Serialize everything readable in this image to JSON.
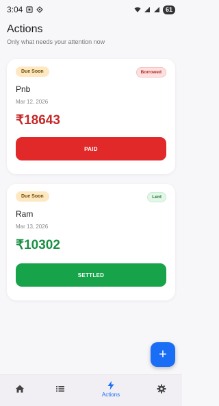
{
  "status_bar": {
    "time": "3:04",
    "battery": "61"
  },
  "header": {
    "title": "Actions",
    "subtitle": "Only what needs your attention now"
  },
  "cards": [
    {
      "due_badge": "Due Soon",
      "type_badge": "Borrowed",
      "name": "Pnb",
      "date": "Mar 12, 2026",
      "amount": "₹18643",
      "button_label": "PAID",
      "amount_color": "#c62828",
      "button_color": "#e12929"
    },
    {
      "due_badge": "Due Soon",
      "type_badge": "Lent",
      "name": "Ram",
      "date": "Mar 13, 2026",
      "amount": "₹10302",
      "button_label": "SETTLED",
      "amount_color": "#1a8f44",
      "button_color": "#16a34a"
    }
  ],
  "fab": {
    "icon": "plus-icon",
    "label": "+"
  },
  "bottom_nav": {
    "items": [
      {
        "icon": "home-icon",
        "label": ""
      },
      {
        "icon": "list-icon",
        "label": ""
      },
      {
        "icon": "bolt-icon",
        "label": "Actions",
        "active": true
      },
      {
        "icon": "gear-icon",
        "label": ""
      }
    ],
    "active_color": "#1a6ef5"
  }
}
